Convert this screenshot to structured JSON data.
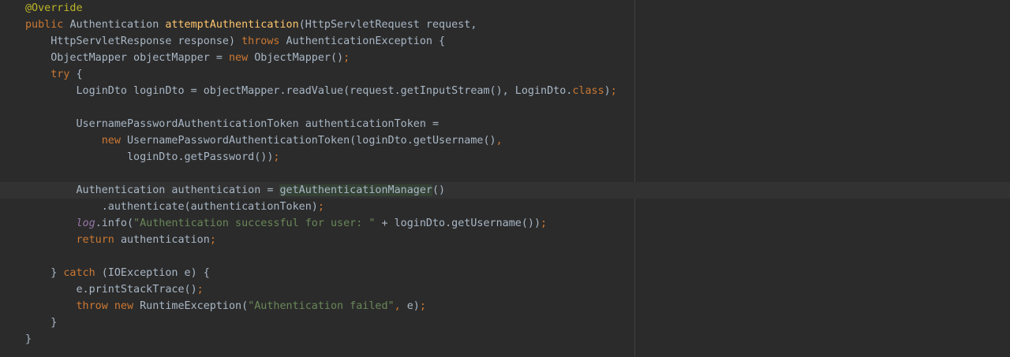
{
  "editor": {
    "lines": [
      [
        {
          "t": "ann",
          "v": "@Override"
        }
      ],
      [
        {
          "t": "kw",
          "v": "public "
        },
        {
          "t": "p",
          "v": "Authentication "
        },
        {
          "t": "mname",
          "v": "attemptAuthentication"
        },
        {
          "t": "p",
          "v": "(HttpServletRequest request,"
        }
      ],
      [
        {
          "t": "p",
          "v": "    HttpServletResponse response) "
        },
        {
          "t": "kw",
          "v": "throws "
        },
        {
          "t": "p",
          "v": "AuthenticationException {"
        }
      ],
      [
        {
          "t": "p",
          "v": "    ObjectMapper objectMapper = "
        },
        {
          "t": "kw",
          "v": "new "
        },
        {
          "t": "p",
          "v": "ObjectMapper()"
        },
        {
          "t": "kw",
          "v": ";"
        }
      ],
      [
        {
          "t": "p",
          "v": "    "
        },
        {
          "t": "kw",
          "v": "try "
        },
        {
          "t": "p",
          "v": "{"
        }
      ],
      [
        {
          "t": "p",
          "v": "        LoginDto loginDto = objectMapper.readValue(request.getInputStream(), LoginDto."
        },
        {
          "t": "kw",
          "v": "class"
        },
        {
          "t": "p",
          "v": ")"
        },
        {
          "t": "kw",
          "v": ";"
        }
      ],
      [],
      [
        {
          "t": "p",
          "v": "        UsernamePasswordAuthenticationToken authenticationToken ="
        }
      ],
      [
        {
          "t": "p",
          "v": "            "
        },
        {
          "t": "kw",
          "v": "new "
        },
        {
          "t": "p",
          "v": "UsernamePasswordAuthenticationToken(loginDto.getUsername()"
        },
        {
          "t": "kw",
          "v": ","
        }
      ],
      [
        {
          "t": "p",
          "v": "                loginDto.getPassword())"
        },
        {
          "t": "kw",
          "v": ";"
        }
      ],
      [],
      [
        {
          "t": "p",
          "v": "        Authentication authentication = "
        },
        {
          "t": "hl",
          "v": "getAuthenticationManager"
        },
        {
          "t": "p",
          "v": "()"
        }
      ],
      [
        {
          "t": "p",
          "v": "            .authenticate(authenticationToken)"
        },
        {
          "t": "kw",
          "v": ";"
        }
      ],
      [
        {
          "t": "p",
          "v": "        "
        },
        {
          "t": "fld",
          "v": "log"
        },
        {
          "t": "p",
          "v": ".info("
        },
        {
          "t": "str",
          "v": "\"Authentication successful for user: \""
        },
        {
          "t": "p",
          "v": " + loginDto.getUsername())"
        },
        {
          "t": "kw",
          "v": ";"
        }
      ],
      [
        {
          "t": "p",
          "v": "        "
        },
        {
          "t": "kw",
          "v": "return "
        },
        {
          "t": "p",
          "v": "authentication"
        },
        {
          "t": "kw",
          "v": ";"
        }
      ],
      [],
      [
        {
          "t": "p",
          "v": "    } "
        },
        {
          "t": "kw",
          "v": "catch "
        },
        {
          "t": "p",
          "v": "(IOException e) {"
        }
      ],
      [
        {
          "t": "p",
          "v": "        e.printStackTrace()"
        },
        {
          "t": "kw",
          "v": ";"
        }
      ],
      [
        {
          "t": "p",
          "v": "        "
        },
        {
          "t": "kw",
          "v": "throw new "
        },
        {
          "t": "p",
          "v": "RuntimeException("
        },
        {
          "t": "str",
          "v": "\"Authentication failed\""
        },
        {
          "t": "kw",
          "v": ", "
        },
        {
          "t": "p",
          "v": "e)"
        },
        {
          "t": "kw",
          "v": ";"
        }
      ],
      [
        {
          "t": "p",
          "v": "    }"
        }
      ],
      [
        {
          "t": "p",
          "v": "}"
        }
      ]
    ],
    "current_line_index": 11,
    "gutter_icon": "lightbulb-icon",
    "colors": {
      "background": "#2b2b2b",
      "keyword": "#cc7832",
      "annotation": "#bbb529",
      "method_declaration": "#ffc66d",
      "string": "#6a8759",
      "static_field": "#9876aa",
      "plain": "#a9b7c6"
    }
  }
}
